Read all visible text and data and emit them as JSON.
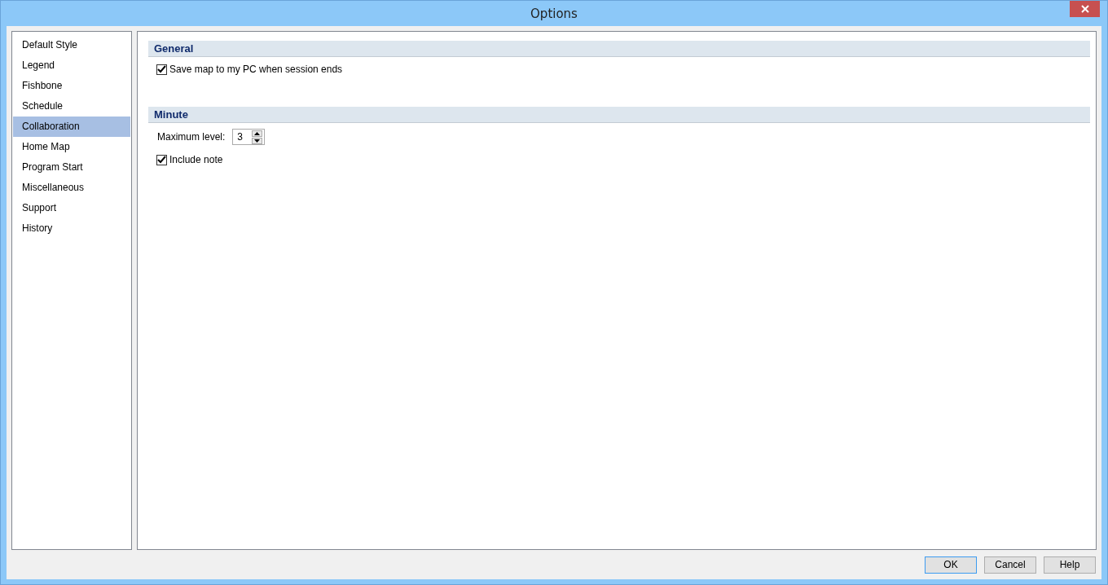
{
  "window": {
    "title": "Options"
  },
  "sidebar": {
    "items": [
      {
        "label": "Default Style",
        "selected": false
      },
      {
        "label": "Legend",
        "selected": false
      },
      {
        "label": "Fishbone",
        "selected": false
      },
      {
        "label": "Schedule",
        "selected": false
      },
      {
        "label": "Collaboration",
        "selected": true
      },
      {
        "label": "Home Map",
        "selected": false
      },
      {
        "label": "Program Start",
        "selected": false
      },
      {
        "label": "Miscellaneous",
        "selected": false
      },
      {
        "label": "Support",
        "selected": false
      },
      {
        "label": "History",
        "selected": false
      }
    ]
  },
  "sections": [
    {
      "title": "General",
      "items": [
        {
          "kind": "checkbox",
          "label": "Save map to my PC when session ends",
          "checked": true
        }
      ]
    },
    {
      "title": "Minute",
      "items": [
        {
          "kind": "spinner",
          "label": "Maximum level:",
          "value": "3"
        },
        {
          "kind": "checkbox",
          "label": "Include note",
          "checked": true
        }
      ]
    }
  ],
  "buttons": [
    {
      "label": "OK",
      "default": true
    },
    {
      "label": "Cancel",
      "default": false
    },
    {
      "label": "Help",
      "default": false
    }
  ]
}
